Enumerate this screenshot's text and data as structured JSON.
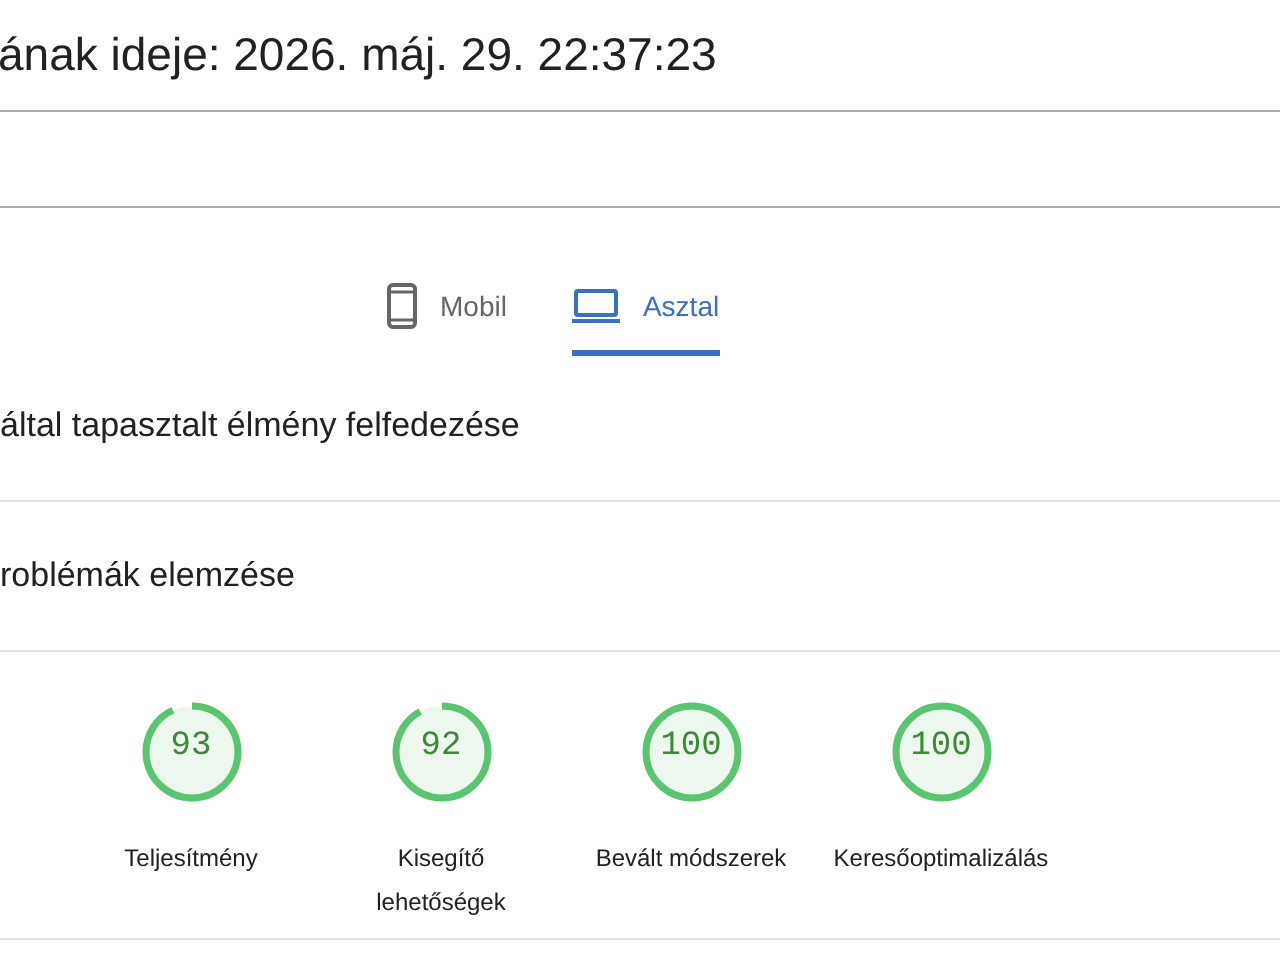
{
  "report_time": "ának ideje: 2026. máj. 29. 22:37:23",
  "tabs": [
    {
      "label": "Mobil",
      "kind": "phone",
      "selected": false
    },
    {
      "label": "Asztal",
      "kind": "laptop",
      "selected": true
    }
  ],
  "sections": [
    {
      "title": "által tapasztalt élmény felfedezése"
    },
    {
      "title": "roblémák elemzése"
    }
  ],
  "scores": [
    {
      "value": "93",
      "label": "Teljesítmény"
    },
    {
      "value": "92",
      "label": "Kisegítő lehetőségek"
    },
    {
      "value": "100",
      "label": "Bevált módszerek"
    },
    {
      "value": "100",
      "label": "Keresőoptimalizálás"
    }
  ]
}
